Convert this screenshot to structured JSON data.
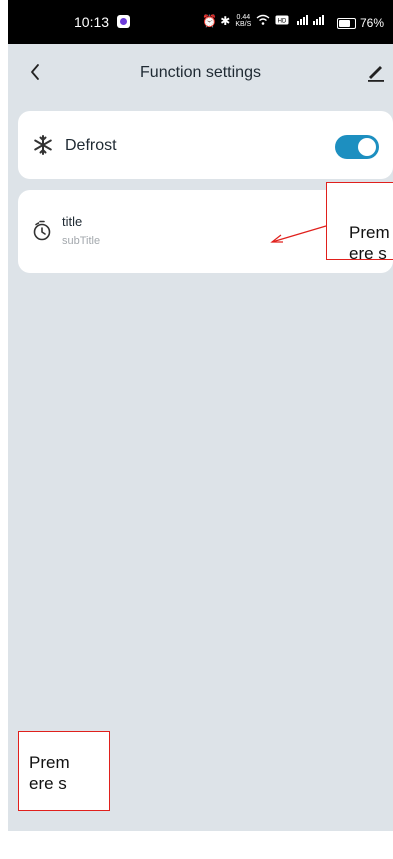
{
  "status_bar": {
    "time": "10:13",
    "icons": "⏰ ✱",
    "net_speed_value": "0.44",
    "net_speed_unit": "KB/S",
    "signal_text": "4G 5G",
    "battery_percent": 76,
    "battery_text": "76%"
  },
  "header": {
    "title": "Function settings",
    "back_icon": "chevron-left-icon",
    "edit_icon": "pencil-icon"
  },
  "settings": {
    "defrost": {
      "label": "Defrost",
      "icon": "snowflake-icon",
      "enabled": true
    },
    "timer": {
      "title": "title",
      "subtitle": "subTitle",
      "icon": "timer-icon"
    }
  },
  "annotations": {
    "top_note_line1": "Prem",
    "top_note_line2": "ere s",
    "bottom_note_line1": "Prem",
    "bottom_note_line2": "ere s"
  },
  "colors": {
    "background": "#dde3e8",
    "toggle_on": "#1d8fc0",
    "annotation_border": "#e0201c"
  }
}
